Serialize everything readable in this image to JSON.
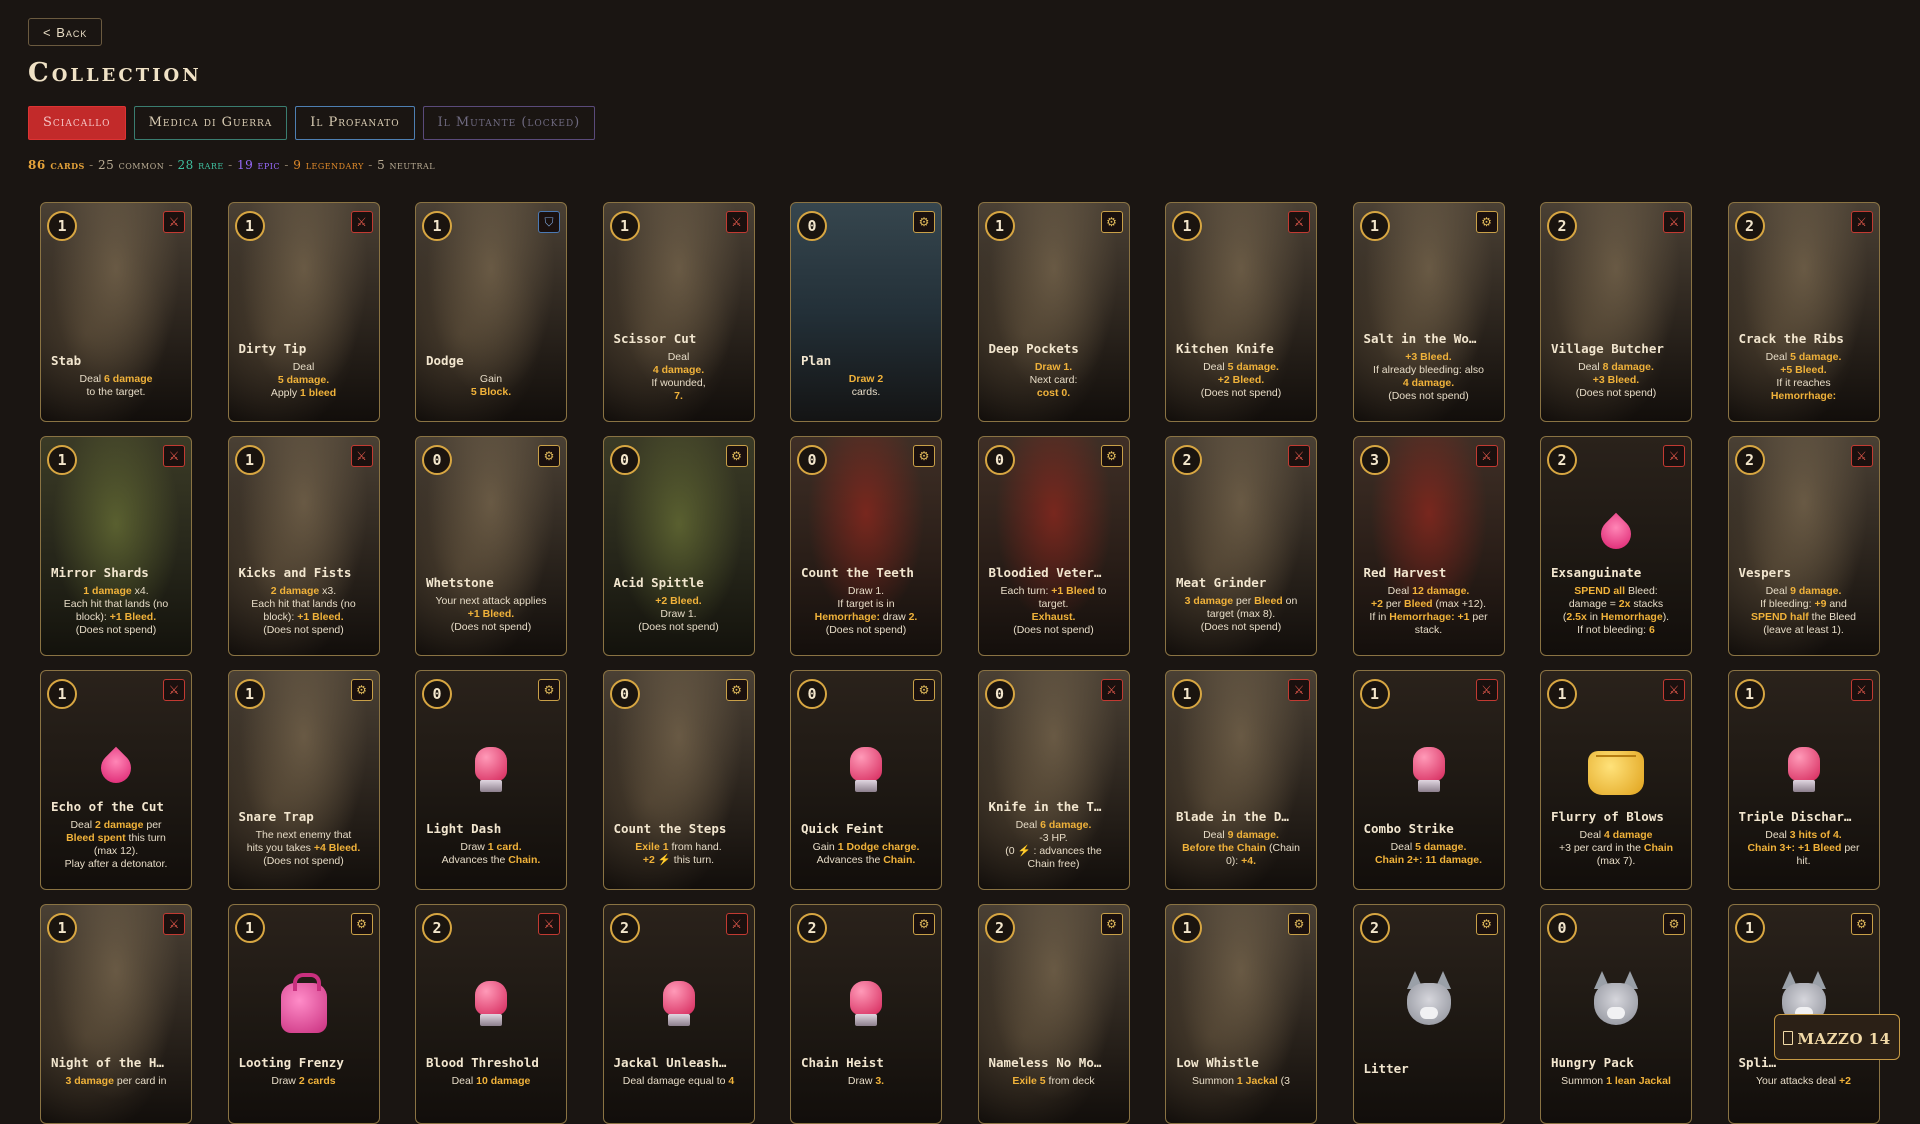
{
  "nav": {
    "back_label": "< Back"
  },
  "page_title": "Collection",
  "tabs": [
    {
      "label": "Sciacallo"
    },
    {
      "label": "Medica di Guerra"
    },
    {
      "label": "Il Profanato"
    },
    {
      "label": "Il Mutante (locked)"
    }
  ],
  "stats": {
    "cards": "86 cards",
    "common": "25 common",
    "rare": "28 rare",
    "epic": "19 epic",
    "legendary": "9 legendary",
    "neutral": "5 neutral",
    "separator": "-"
  },
  "deck_button": {
    "label": "MAZZO 14"
  },
  "colors": {
    "accent": "#c22a2a",
    "gold": "#d7a642",
    "highlight": "#f0b23a",
    "bleed": "#e04b3c"
  },
  "cards": [
    {
      "cost": "1",
      "type": "attack",
      "icon": "crossed-swords-icon",
      "art": "art",
      "name": "Stab",
      "lines": [
        "Deal <b>6 damage</b>",
        "to the target."
      ]
    },
    {
      "cost": "1",
      "type": "attack",
      "icon": "crossed-swords-icon",
      "art": "art",
      "name": "Dirty Tip",
      "lines": [
        "Deal",
        "<b>5 damage.</b>",
        "Apply <b>1 bleed</b>"
      ]
    },
    {
      "cost": "1",
      "type": "defense",
      "icon": "shield-icon",
      "art": "art",
      "name": "Dodge",
      "lines": [
        "Gain",
        "<b>5 Block.</b>"
      ]
    },
    {
      "cost": "1",
      "type": "attack",
      "icon": "crossed-swords-icon",
      "art": "art",
      "name": "Scissor Cut",
      "lines": [
        "Deal",
        "<b>4 damage.</b>",
        "If wounded,",
        "<b>7.</b>"
      ]
    },
    {
      "cost": "0",
      "type": "skill",
      "icon": "gear-icon",
      "art": "blue",
      "name": "Plan",
      "lines": [
        "<b>Draw 2</b>",
        "cards."
      ]
    },
    {
      "cost": "1",
      "type": "skill",
      "icon": "gear-icon",
      "art": "art",
      "name": "Deep Pockets",
      "lines": [
        "<b>Draw 1.</b>",
        "Next card:",
        "<b>cost 0.</b>"
      ]
    },
    {
      "cost": "1",
      "type": "attack",
      "icon": "crossed-swords-icon",
      "art": "art",
      "name": "Kitchen Knife",
      "lines": [
        "Deal <b>5 damage.</b>",
        "<b>+2 Bleed.</b>",
        "(Does not spend)"
      ]
    },
    {
      "cost": "1",
      "type": "skill",
      "icon": "gear-icon",
      "art": "art",
      "name": "Salt in the Wo…",
      "lines": [
        "<b>+3 Bleed.</b>",
        "If already bleeding: also",
        "<b>4 damage.</b>",
        "(Does not spend)"
      ]
    },
    {
      "cost": "2",
      "type": "attack",
      "icon": "crossed-swords-icon",
      "art": "art",
      "name": "Village Butcher",
      "lines": [
        "Deal <b>8 damage.</b>",
        "<b>+3 Bleed.</b>",
        "(Does not spend)"
      ]
    },
    {
      "cost": "2",
      "type": "attack",
      "icon": "crossed-swords-icon",
      "art": "art",
      "name": "Crack the Ribs",
      "lines": [
        "Deal <b>5 damage.</b>",
        "<b>+5 Bleed.</b>",
        "If it reaches",
        "<b>Hemorrhage:</b>"
      ]
    },
    {
      "cost": "1",
      "type": "attack",
      "icon": "crossed-swords-icon",
      "art": "green",
      "name": "Mirror Shards",
      "lines": [
        "<b>1 damage</b> x4.",
        "Each hit that lands (no",
        "block): <b>+1 Bleed.</b>",
        "(Does not spend)"
      ]
    },
    {
      "cost": "1",
      "type": "attack",
      "icon": "crossed-swords-icon",
      "art": "art",
      "name": "Kicks and Fists",
      "lines": [
        "<b>2 damage</b> x3.",
        "Each hit that lands (no",
        "block): <b>+1 Bleed.</b>",
        "(Does not spend)"
      ]
    },
    {
      "cost": "0",
      "type": "skill",
      "icon": "gear-icon",
      "art": "art",
      "name": "Whetstone",
      "lines": [
        "Your next attack applies",
        "<b>+1 Bleed.</b>",
        "(Does not spend)"
      ]
    },
    {
      "cost": "0",
      "type": "skill",
      "icon": "gear-icon",
      "art": "green",
      "name": "Acid Spittle",
      "lines": [
        "<b>+2 Bleed.</b>",
        "Draw 1.",
        "(Does not spend)"
      ]
    },
    {
      "cost": "0",
      "type": "skill",
      "icon": "gear-icon",
      "art": "red",
      "name": "Count the Teeth",
      "lines": [
        "Draw 1.",
        "If target is in",
        "<b>Hemorrhage:</b> draw <b>2.</b>",
        "(Does not spend)"
      ]
    },
    {
      "cost": "0",
      "type": "skill",
      "icon": "gear-icon",
      "art": "red",
      "name": "Bloodied Veter…",
      "lines": [
        "Each turn: <b>+1 Bleed</b> to",
        "target.",
        "<b>Exhaust.</b>",
        "(Does not spend)"
      ]
    },
    {
      "cost": "2",
      "type": "attack",
      "icon": "crossed-swords-icon",
      "art": "art",
      "name": "Meat Grinder",
      "lines": [
        "<b>3 damage</b> per <b>Bleed</b> on",
        "target (max 8).",
        "(Does not spend)"
      ]
    },
    {
      "cost": "3",
      "type": "attack",
      "icon": "crossed-swords-icon",
      "art": "red",
      "name": "Red Harvest",
      "lines": [
        "Deal <b>12 damage.</b>",
        "<b>+2</b> per <b>Bleed</b> (max +12).",
        "If in <b>Hemorrhage: +1</b> per",
        "stack."
      ]
    },
    {
      "cost": "2",
      "type": "attack",
      "icon": "crossed-swords-icon",
      "art": "plain",
      "figure": "drop",
      "name": "Exsanguinate",
      "lines": [
        "<b>SPEND all</b> Bleed:",
        "damage = <b>2x</b> stacks",
        "(<b>2.5x</b> in <b>Hemorrhage</b>).",
        "If not bleeding: <b>6</b>"
      ]
    },
    {
      "cost": "2",
      "type": "attack",
      "icon": "crossed-swords-icon",
      "art": "art",
      "name": "Vespers",
      "lines": [
        "Deal <b>9 damage.</b>",
        "If bleeding: <b>+9</b> and",
        "<b>SPEND half</b> the Bleed",
        "(leave at least 1)."
      ]
    },
    {
      "cost": "1",
      "type": "attack",
      "icon": "crossed-swords-icon",
      "art": "plain",
      "figure": "drop",
      "name": "Echo of the Cut",
      "lines": [
        "Deal <b>2 damage</b> per",
        "<b>Bleed spent</b> this turn",
        "(max 12).",
        "Play after a detonator."
      ]
    },
    {
      "cost": "1",
      "type": "skill",
      "icon": "gear-icon",
      "art": "art",
      "name": "Snare Trap",
      "lines": [
        "The next enemy that",
        "hits you takes <b>+4 Bleed.</b>",
        "(Does not spend)"
      ]
    },
    {
      "cost": "0",
      "type": "skill",
      "icon": "gear-icon",
      "art": "plain",
      "figure": "glove",
      "name": "Light Dash",
      "lines": [
        "Draw <b>1 card.</b>",
        "Advances the <b>Chain.</b>"
      ]
    },
    {
      "cost": "0",
      "type": "skill",
      "icon": "gear-icon",
      "art": "art",
      "name": "Count the Steps",
      "lines": [
        "<b>Exile 1</b> from hand.",
        "<b>+2 ⚡</b> this turn."
      ]
    },
    {
      "cost": "0",
      "type": "skill",
      "icon": "gear-icon",
      "art": "plain",
      "figure": "glove",
      "name": "Quick Feint",
      "lines": [
        "Gain <b>1 Dodge charge.</b>",
        "Advances the <b>Chain.</b>"
      ]
    },
    {
      "cost": "0",
      "type": "attack",
      "icon": "crossed-swords-icon",
      "art": "art",
      "name": "Knife in the T…",
      "lines": [
        "Deal <b>6 damage.</b>",
        "-3 HP.",
        "(0 <b>⚡</b> : advances the",
        "Chain free)"
      ]
    },
    {
      "cost": "1",
      "type": "attack",
      "icon": "crossed-swords-icon",
      "art": "art",
      "name": "Blade in the D…",
      "lines": [
        "Deal <b>9 damage.</b>",
        "<b>Before the Chain</b> (Chain",
        "0): <b>+4.</b>"
      ]
    },
    {
      "cost": "1",
      "type": "attack",
      "icon": "crossed-swords-icon",
      "art": "plain",
      "figure": "glove",
      "name": "Combo Strike",
      "lines": [
        "Deal <b>5 damage.</b>",
        "<b>Chain 2+: 11 damage.</b>"
      ]
    },
    {
      "cost": "1",
      "type": "attack",
      "icon": "crossed-swords-icon",
      "art": "plain",
      "figure": "fist",
      "name": "Flurry of Blows",
      "lines": [
        "Deal <b>4 damage</b>",
        "+3 per card in the <b>Chain</b>",
        "(max 7)."
      ]
    },
    {
      "cost": "1",
      "type": "attack",
      "icon": "crossed-swords-icon",
      "art": "plain",
      "figure": "glove",
      "name": "Triple Dischar…",
      "lines": [
        "Deal <b>3 hits of 4.</b>",
        "<b>Chain 3+: +1 Bleed</b> per",
        "hit."
      ]
    },
    {
      "cost": "1",
      "type": "attack",
      "icon": "crossed-swords-icon",
      "art": "art",
      "name": "Night of the H…",
      "lines": [
        "<b>3 damage</b> per card in"
      ]
    },
    {
      "cost": "1",
      "type": "skill",
      "icon": "gear-icon",
      "art": "plain",
      "figure": "bag",
      "name": "Looting Frenzy",
      "lines": [
        "Draw <b>2 cards</b>"
      ]
    },
    {
      "cost": "2",
      "type": "attack",
      "icon": "crossed-swords-icon",
      "art": "plain",
      "figure": "glove",
      "name": "Blood Threshold",
      "lines": [
        "Deal <b>10 damage</b>"
      ]
    },
    {
      "cost": "2",
      "type": "attack",
      "icon": "crossed-swords-icon",
      "art": "plain",
      "figure": "glove",
      "name": "Jackal Unleash…",
      "lines": [
        "Deal damage equal to <b>4</b>"
      ]
    },
    {
      "cost": "2",
      "type": "skill",
      "icon": "gear-icon",
      "art": "plain",
      "figure": "glove",
      "name": "Chain Heist",
      "lines": [
        "Draw <b>3.</b>"
      ]
    },
    {
      "cost": "2",
      "type": "skill",
      "icon": "gear-icon",
      "art": "art",
      "name": "Nameless No Mo…",
      "lines": [
        "<b>Exile 5</b> from deck"
      ]
    },
    {
      "cost": "1",
      "type": "skill",
      "icon": "gear-icon",
      "art": "art",
      "name": "Low Whistle",
      "lines": [
        "Summon <b>1 Jackal</b> (3"
      ]
    },
    {
      "cost": "2",
      "type": "skill",
      "icon": "gear-icon",
      "art": "plain",
      "figure": "wolf",
      "name": "Litter",
      "lines": []
    },
    {
      "cost": "0",
      "type": "skill",
      "icon": "gear-icon",
      "art": "plain",
      "figure": "wolf",
      "name": "Hungry Pack",
      "lines": [
        "Summon <b>1 lean Jackal</b>"
      ]
    },
    {
      "cost": "1",
      "type": "skill",
      "icon": "gear-icon",
      "art": "plain",
      "figure": "wolf",
      "name": "Spli…",
      "lines": [
        "Your attacks deal <b>+2</b>"
      ]
    }
  ]
}
